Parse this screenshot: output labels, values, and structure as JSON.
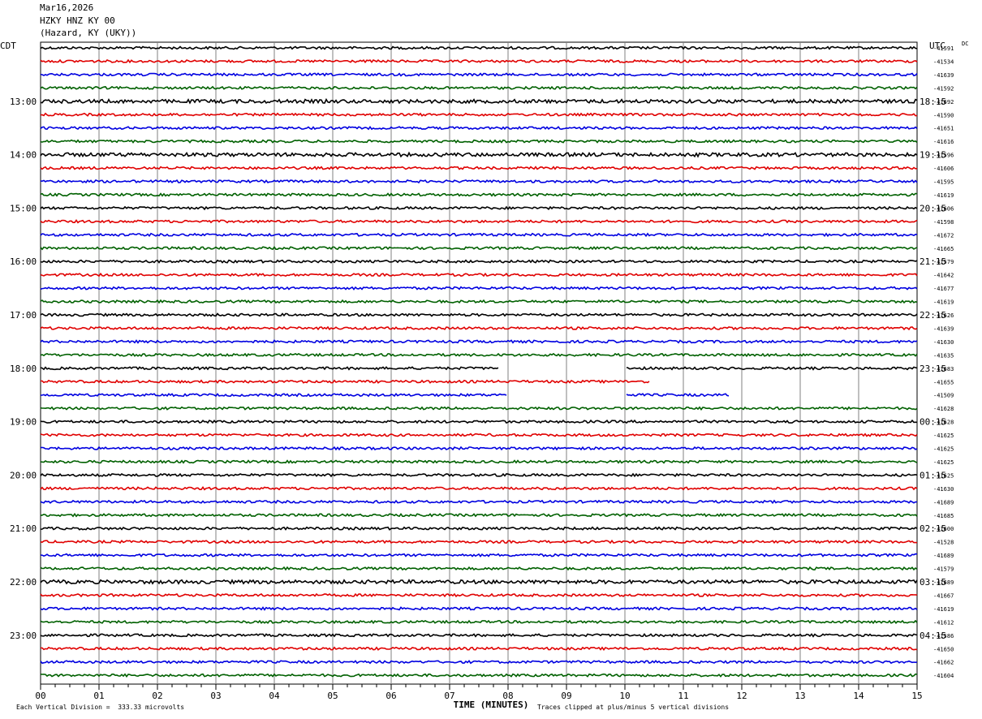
{
  "header": {
    "date": "Mar16,2026",
    "station": "HZKY HNZ KY 00",
    "location": "(Hazard, KY (UKY))"
  },
  "left_tz": "CDT",
  "right_tz": "UTC",
  "dc_label": "DC",
  "footer": {
    "scale_note": "Each Vertical Division =  333.33 microvolts",
    "clip_note": "Traces clipped at plus/minus 5 vertical divisions"
  },
  "chart_data": {
    "type": "line",
    "title": "",
    "xlabel": "TIME (MINUTES)",
    "xlim": [
      0,
      15
    ],
    "x_ticks": [
      "00",
      "01",
      "02",
      "03",
      "04",
      "05",
      "06",
      "07",
      "08",
      "09",
      "10",
      "11",
      "12",
      "13",
      "14",
      "15"
    ],
    "grid": true,
    "trace_colors": [
      "#000000",
      "#e00000",
      "#0000e0",
      "#006000"
    ],
    "left_hour_labels": [
      "13:00",
      "14:00",
      "15:00",
      "16:00",
      "17:00",
      "18:00",
      "19:00",
      "20:00",
      "21:00",
      "22:00",
      "23:00"
    ],
    "right_hour_labels": [
      "18:15",
      "19:15",
      "20:15",
      "21:15",
      "22:15",
      "23:15",
      "00:15",
      "01:15",
      "02:15",
      "03:15",
      "04:15"
    ],
    "dc_offsets": [
      "-41591",
      "-41534",
      "-41639",
      "-41592",
      "-41692",
      "-41590",
      "-41651",
      "-41616",
      "-41596",
      "-41606",
      "-41595",
      "-41619",
      "-41606",
      "-41598",
      "-41672",
      "-41665",
      "-41579",
      "-41642",
      "-41677",
      "-41619",
      "-41626",
      "-41639",
      "-41630",
      "-41635",
      "-41683",
      "-41655",
      "-41509",
      "-41628",
      "-41628",
      "-41625",
      "-41625",
      "-41625",
      "-41625",
      "-41630",
      "-41689",
      "-41685",
      "-41600",
      "-41528",
      "-41689",
      "-41579",
      "-41689",
      "-41667",
      "-41619",
      "-41612",
      "-41586",
      "-41650",
      "-41662",
      "-41604"
    ],
    "gaps": [
      {
        "trace": 24,
        "from_min": 7.85,
        "to_min": 10.0
      },
      {
        "trace": 25,
        "from_min": 10.42,
        "to_min": 15.0
      },
      {
        "trace": 26,
        "from_min": 8.0,
        "to_min": 10.0
      },
      {
        "trace": 26,
        "from_min": 11.8,
        "to_min": 15.0
      }
    ],
    "trace_count": 48
  }
}
